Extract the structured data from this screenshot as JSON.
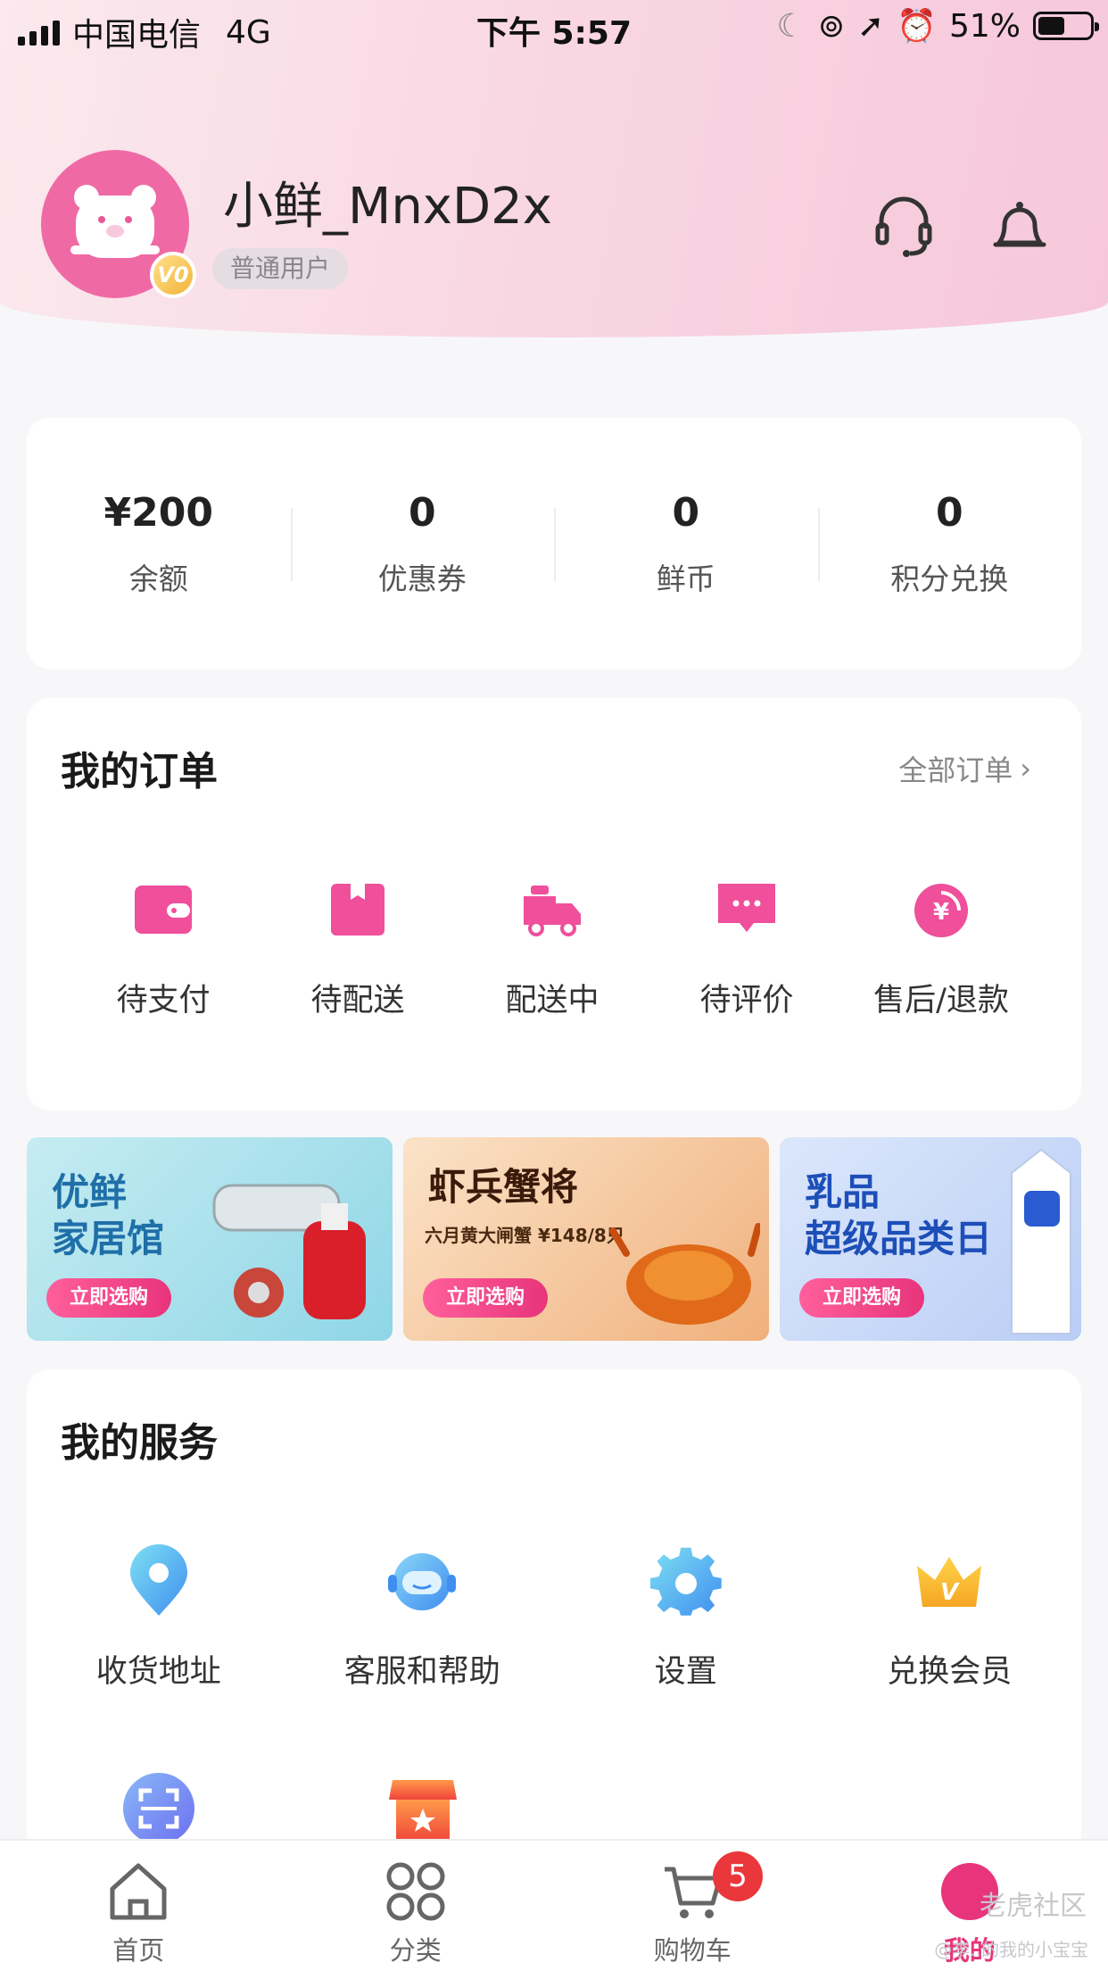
{
  "status_bar": {
    "carrier": "中国电信",
    "network": "4G",
    "time": "下午 5:57",
    "battery": "51%"
  },
  "profile": {
    "username": "小鲜_MnxD2x",
    "level_badge": "V0",
    "user_type": "普通用户",
    "icons": [
      "headset-icon",
      "bell-icon"
    ]
  },
  "stats": [
    {
      "value": "¥200",
      "label": "余额"
    },
    {
      "value": "0",
      "label": "优惠券"
    },
    {
      "value": "0",
      "label": "鲜币"
    },
    {
      "value": "0",
      "label": "积分兑换"
    }
  ],
  "orders": {
    "title": "我的订单",
    "all_link": "全部订单",
    "items": [
      {
        "label": "待支付",
        "icon": "wallet-icon"
      },
      {
        "label": "待配送",
        "icon": "box-icon"
      },
      {
        "label": "配送中",
        "icon": "delivery-truck-icon"
      },
      {
        "label": "待评价",
        "icon": "comment-icon"
      },
      {
        "label": "售后/退款",
        "icon": "refund-icon"
      }
    ]
  },
  "banners": [
    {
      "title_line1": "优鲜",
      "title_line2": "家居馆",
      "subtitle": "",
      "button": "立即选购"
    },
    {
      "title_line1": "虾兵蟹将",
      "title_line2": "",
      "subtitle": "六月黄大闸蟹 ¥148/8只",
      "button": "立即选购"
    },
    {
      "title_line1": "乳品",
      "title_line2": "超级品类日",
      "subtitle": "",
      "button": "立即选购"
    }
  ],
  "services": {
    "title": "我的服务",
    "items": [
      {
        "label": "收货地址",
        "icon": "location-pin-icon"
      },
      {
        "label": "客服和帮助",
        "icon": "customer-service-icon"
      },
      {
        "label": "设置",
        "icon": "gear-icon"
      },
      {
        "label": "兑换会员",
        "icon": "crown-icon"
      },
      {
        "label": "",
        "icon": "scan-icon"
      },
      {
        "label": "",
        "icon": "store-icon"
      }
    ]
  },
  "tabbar": {
    "tabs": [
      {
        "label": "首页",
        "icon": "home-icon"
      },
      {
        "label": "分类",
        "icon": "category-grid-icon"
      },
      {
        "label": "购物车",
        "icon": "cart-icon",
        "badge": "5"
      },
      {
        "label": "我的",
        "icon": "profile-icon"
      }
    ]
  },
  "watermark": {
    "line1": "老虎社区",
    "line2": "@李..的我的小宝宝"
  },
  "colors": {
    "accent": "#e8347b",
    "pink_icon": "#ef4f9b",
    "badge_red": "#e9373c"
  }
}
